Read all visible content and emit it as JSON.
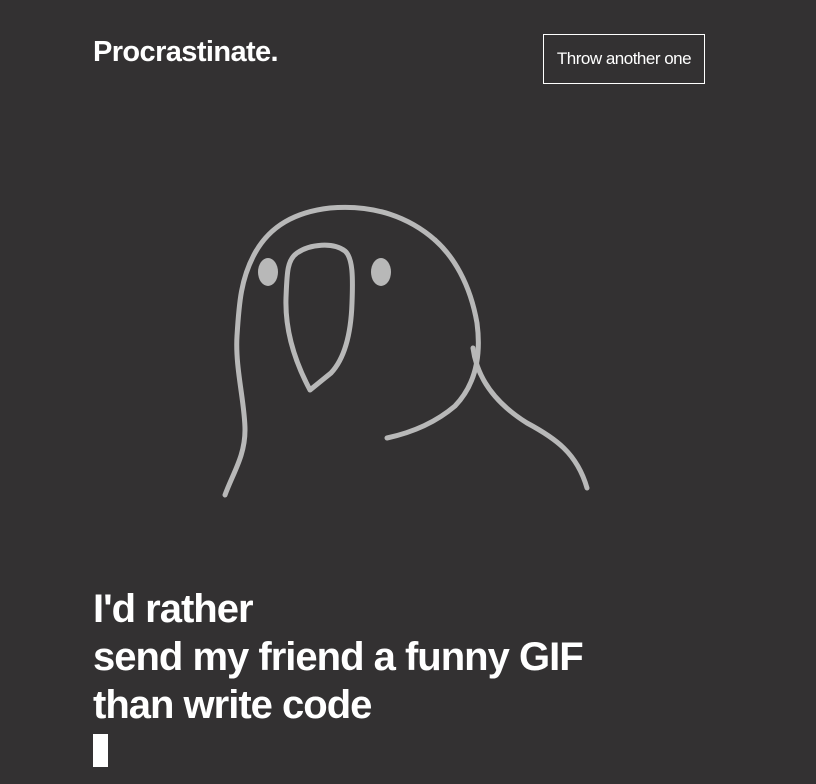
{
  "header": {
    "brand": "Procrastinate.",
    "throw_button_label": "Throw another one"
  },
  "illustration": {
    "icon": "parrot-line-drawing",
    "stroke_color": "#b8b8b8"
  },
  "message": {
    "lines": [
      "I'd rather",
      "send my friend a funny GIF",
      "than write code"
    ]
  },
  "colors": {
    "background": "#333132",
    "text": "#ffffff"
  }
}
